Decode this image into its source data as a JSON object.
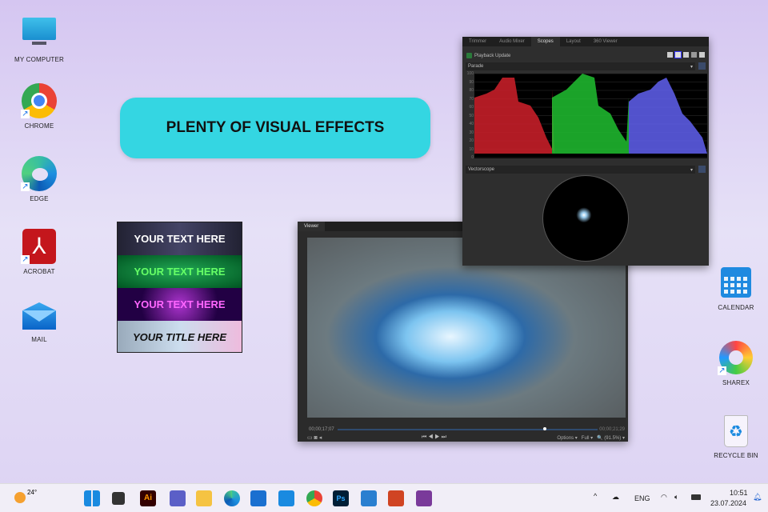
{
  "desktop": {
    "icons": [
      {
        "label": "MY COMPUTER",
        "icon": "monitor-icon"
      },
      {
        "label": "CHROME",
        "icon": "chrome-icon"
      },
      {
        "label": "EDGE",
        "icon": "edge-icon"
      },
      {
        "label": "ACROBAT",
        "icon": "acrobat-icon"
      },
      {
        "label": "MAIL",
        "icon": "mail-icon"
      },
      {
        "label": "CALENDAR",
        "icon": "calendar-icon"
      },
      {
        "label": "SHAREX",
        "icon": "sharex-icon"
      },
      {
        "label": "RECYCLE BIN",
        "icon": "recycle-bin-icon"
      }
    ]
  },
  "banner": {
    "text": "PLENTY OF VISUAL EFFECTS"
  },
  "thumbnail": {
    "lines": [
      "YOUR TEXT HERE",
      "YOUR TEXT HERE",
      "YOUR TEXT HERE",
      "YOUR TITLE HERE"
    ]
  },
  "viewer": {
    "tab": "Viewer",
    "current_time": "00;00;17;07",
    "total_time": "00;00;21;29",
    "progress": 0.79,
    "options": "Options",
    "quality": "Full",
    "zoom": "(91.5%)"
  },
  "scopes": {
    "tabs": [
      "Trimmer",
      "Audio Mixer",
      "Scopes",
      "Layout",
      "360 Viewer"
    ],
    "active_tab": "Scopes",
    "playback_update": "Playback Update",
    "scope1": "Parade",
    "scope2": "Vectorscope",
    "y_ticks": [
      "100",
      "90",
      "80",
      "70",
      "60",
      "50",
      "40",
      "30",
      "20",
      "10",
      "0"
    ]
  },
  "taskbar": {
    "weather": "24°",
    "language": "ENG",
    "time": "10:51",
    "date": "23.07.2024"
  }
}
